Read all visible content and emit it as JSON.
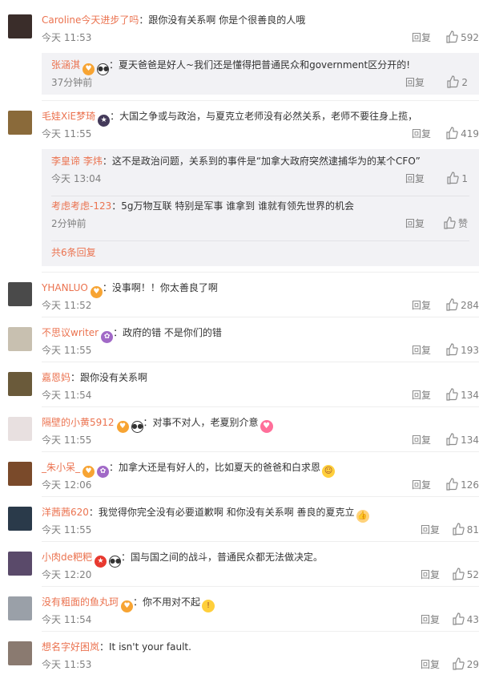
{
  "comments": [
    {
      "user": "Caroline今天进步了吗",
      "text": "：跟你没有关系啊 你是个很善良的人哦",
      "time": "今天 11:53",
      "reply_label": "回复",
      "likes": "592",
      "avatar_color": "#3a2d2a",
      "badges": [],
      "sub_replies": [
        {
          "user": "张涵淇",
          "text": "：夏天爸爸是好人~我们还是懂得把普通民众和government区分开的!",
          "time": "37分钟前",
          "reply_label": "回复",
          "likes": "2",
          "badges": [
            "orange",
            "panda"
          ]
        }
      ]
    },
    {
      "user": "毛娃XiE梦琦",
      "text": "：大国之争或与政治，与夏克立老师没有必然关系，老师不要往身上揽，",
      "time": "今天 11:55",
      "reply_label": "回复",
      "likes": "419",
      "avatar_color": "#8a6a3a",
      "badges": [
        "dark"
      ],
      "sub_replies": [
        {
          "user": "李皇谛 李炜",
          "text": "：这不是政治问题，关系到的事件是“加拿大政府突然逮捕华为的某个CFO”",
          "time": "今天 13:04",
          "reply_label": "回复",
          "likes": "1",
          "badges": []
        },
        {
          "user": "考虑考虑-123",
          "text": "：5g万物互联  特别是军事  谁拿到  谁就有领先世界的机会",
          "time": "2分钟前",
          "reply_label": "回复",
          "likes": "赞",
          "badges": []
        }
      ],
      "more_label": "共6条回复"
    },
    {
      "user": "YHANLUO",
      "text": "：没事啊！！你太善良了啊",
      "time": "今天 11:52",
      "reply_label": "回复",
      "likes": "284",
      "avatar_color": "#4a4a4a",
      "badges": [
        "orange"
      ]
    },
    {
      "user": "不思议writer",
      "text": "：政府的错 不是你们的错",
      "time": "今天 11:55",
      "reply_label": "回复",
      "likes": "193",
      "avatar_color": "#c8c0b0",
      "badges": [
        "purple"
      ]
    },
    {
      "user": "嘉恩妈",
      "text": "：跟你没有关系啊",
      "time": "今天 11:54",
      "reply_label": "回复",
      "likes": "134",
      "avatar_color": "#6a5a3a",
      "badges": []
    },
    {
      "user": "隔壁的小黄5912",
      "text": "：对事不对人，老夏别介意",
      "time": "今天 11:55",
      "reply_label": "回复",
      "likes": "134",
      "avatar_color": "#e8e0e0",
      "badges": [
        "orange",
        "panda"
      ],
      "emoji": "heart"
    },
    {
      "user": "_朱小呆_",
      "text": "：加拿大还是有好人的，比如夏天的爸爸和白求恩",
      "time": "今天 12:06",
      "reply_label": "回复",
      "likes": "126",
      "avatar_color": "#7a4a2a",
      "badges": [
        "orange",
        "purple"
      ],
      "emoji": "grin"
    },
    {
      "user": "洋茜茜620",
      "text": "：我觉得你完全没有必要道歉啊 和你没有关系啊 善良的夏克立",
      "time": "今天 11:55",
      "reply_label": "回复",
      "likes": "81",
      "avatar_color": "#2a3a4a",
      "badges": [],
      "emoji": "thumb"
    },
    {
      "user": "小肉de粑粑",
      "text": "：国与国之间的战斗，普通民众都无法做决定。",
      "time": "今天 12:20",
      "reply_label": "回复",
      "likes": "52",
      "avatar_color": "#5a4a6a",
      "badges": [
        "red",
        "panda"
      ]
    },
    {
      "user": "没有粗面的鱼丸珂",
      "text": "：你不用对不起",
      "time": "今天 11:54",
      "reply_label": "回复",
      "likes": "43",
      "avatar_color": "#9aa0a8",
      "badges": [
        "orange"
      ],
      "emoji": "scream"
    },
    {
      "user": "想名字好困岚",
      "text": "：It isn't your fault.",
      "time": "今天 11:53",
      "reply_label": "回复",
      "likes": "29",
      "avatar_color": "#8a7a70",
      "badges": []
    }
  ],
  "icons": {
    "like": "thumbs-up-icon"
  }
}
